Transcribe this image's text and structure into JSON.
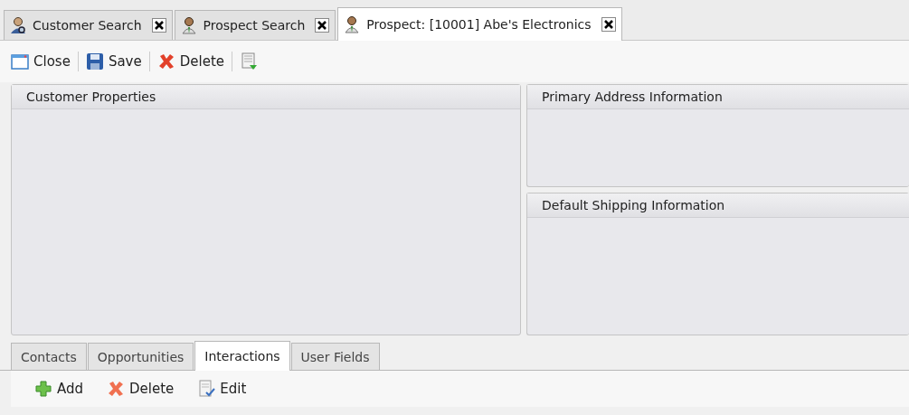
{
  "document_tabs": [
    {
      "label": "Customer Search",
      "kind": "customer",
      "selected": false
    },
    {
      "label": "Prospect Search",
      "kind": "prospect",
      "selected": false
    },
    {
      "label": "Prospect: [10001] Abe's Electronics",
      "kind": "prospect",
      "selected": true
    }
  ],
  "toolbar": [
    {
      "label": "Close",
      "kind": "window"
    },
    {
      "label": "Save",
      "kind": "save"
    },
    {
      "label": "Delete",
      "kind": "delete"
    },
    {
      "kind": "export"
    }
  ],
  "panels": {
    "left": {
      "title": "Customer Properties"
    },
    "right": [
      {
        "title": "Primary Address Information"
      },
      {
        "title": "Default Shipping Information"
      }
    ]
  },
  "detail_tabs": [
    {
      "label": "Contacts",
      "selected": false
    },
    {
      "label": "Opportunities",
      "selected": false
    },
    {
      "label": "Interactions",
      "selected": true
    },
    {
      "label": "User Fields",
      "selected": false
    }
  ],
  "detail_toolbar": [
    {
      "label": "Add",
      "kind": "add"
    },
    {
      "label": "Delete",
      "kind": "delete"
    },
    {
      "label": "Edit",
      "kind": "edit"
    }
  ]
}
